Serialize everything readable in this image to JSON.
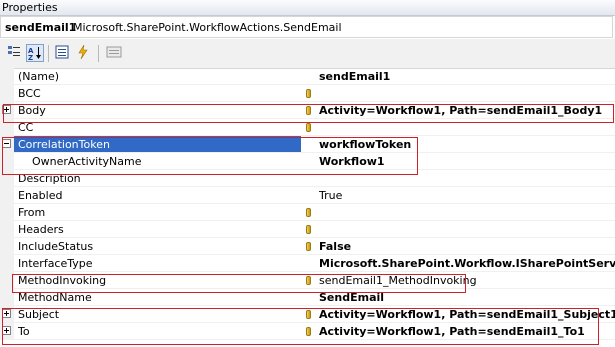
{
  "window": {
    "title": "Properties"
  },
  "object_selector": {
    "name": "sendEmail1",
    "type": "Microsoft.SharePoint.WorkflowActions.SendEmail"
  },
  "toolbar": {
    "buttons": [
      {
        "icon": "categorized-icon"
      },
      {
        "icon": "alphabetical-sort-icon",
        "selected": true
      },
      {
        "icon": "properties-icon"
      },
      {
        "icon": "events-lightning-icon"
      },
      {
        "icon": "property-pages-icon"
      }
    ]
  },
  "properties": [
    {
      "name": "(Name)",
      "value": "sendEmail1",
      "bold": true,
      "bindable": false,
      "expander": ""
    },
    {
      "name": "BCC",
      "value": "",
      "bold": false,
      "bindable": true,
      "expander": ""
    },
    {
      "name": "Body",
      "value": "Activity=Workflow1, Path=sendEmail1_Body1",
      "bold": true,
      "bindable": true,
      "expander": "plus"
    },
    {
      "name": "CC",
      "value": "",
      "bold": false,
      "bindable": true,
      "expander": ""
    },
    {
      "name": "CorrelationToken",
      "value": "workflowToken",
      "bold": true,
      "bindable": false,
      "expander": "minus",
      "selected": true
    },
    {
      "name": "OwnerActivityName",
      "value": "Workflow1",
      "bold": true,
      "bindable": false,
      "expander": "",
      "indent": true
    },
    {
      "name": "Description",
      "value": "",
      "bold": false,
      "bindable": false,
      "expander": ""
    },
    {
      "name": "Enabled",
      "value": "True",
      "bold": false,
      "bindable": false,
      "expander": ""
    },
    {
      "name": "From",
      "value": "",
      "bold": false,
      "bindable": true,
      "expander": ""
    },
    {
      "name": "Headers",
      "value": "",
      "bold": false,
      "bindable": true,
      "expander": ""
    },
    {
      "name": "IncludeStatus",
      "value": "False",
      "bold": true,
      "bindable": true,
      "expander": ""
    },
    {
      "name": "InterfaceType",
      "value": "Microsoft.SharePoint.Workflow.ISharePointService",
      "bold": true,
      "bindable": false,
      "expander": ""
    },
    {
      "name": "MethodInvoking",
      "value": "sendEmail1_MethodInvoking",
      "bold": false,
      "bindable": true,
      "expander": ""
    },
    {
      "name": "MethodName",
      "value": "SendEmail",
      "bold": true,
      "bindable": false,
      "expander": ""
    },
    {
      "name": "Subject",
      "value": "Activity=Workflow1, Path=sendEmail1_Subject1",
      "bold": true,
      "bindable": true,
      "expander": "plus"
    },
    {
      "name": "To",
      "value": "Activity=Workflow1, Path=sendEmail1_To1",
      "bold": true,
      "bindable": true,
      "expander": "plus"
    }
  ],
  "colors": {
    "highlight_box": "#d0202a",
    "selection": "#3169c6"
  }
}
